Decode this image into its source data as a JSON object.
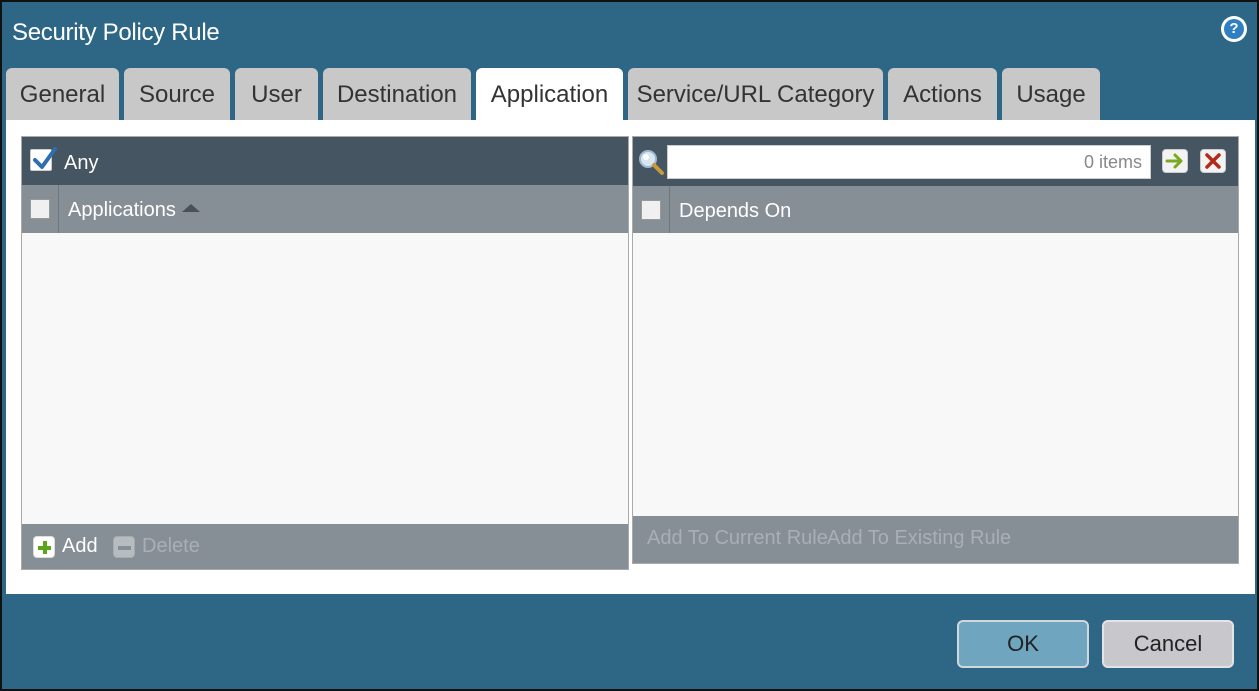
{
  "dialog": {
    "title": "Security Policy Rule"
  },
  "tabs": [
    {
      "label": "General"
    },
    {
      "label": "Source"
    },
    {
      "label": "User"
    },
    {
      "label": "Destination"
    },
    {
      "label": "Application",
      "active": true
    },
    {
      "label": "Service/URL Category"
    },
    {
      "label": "Actions"
    },
    {
      "label": "Usage"
    }
  ],
  "applications": {
    "any_label": "Any",
    "any_checked": true,
    "column_header": "Applications",
    "add_label": "Add",
    "delete_label": "Delete",
    "rows": []
  },
  "depends_on": {
    "search_value": "0 items",
    "column_header": "Depends On",
    "add_current_label": "Add To Current Rule",
    "add_existing_label": "Add To Existing Rule",
    "rows": []
  },
  "footer": {
    "ok_label": "OK",
    "cancel_label": "Cancel"
  },
  "colors": {
    "dialog_bg": "#2e6786",
    "panel_header_dark": "#465562",
    "panel_header_gray": "#868e96",
    "tab_inactive": "#c8c8c8",
    "ok_button": "#6fa5be"
  },
  "icons": {
    "help": "help-icon",
    "search": "search-icon",
    "go": "arrow-right-icon",
    "clear": "clear-x-icon",
    "add": "plus-icon",
    "delete": "minus-icon",
    "sort": "sort-ascending-icon"
  }
}
